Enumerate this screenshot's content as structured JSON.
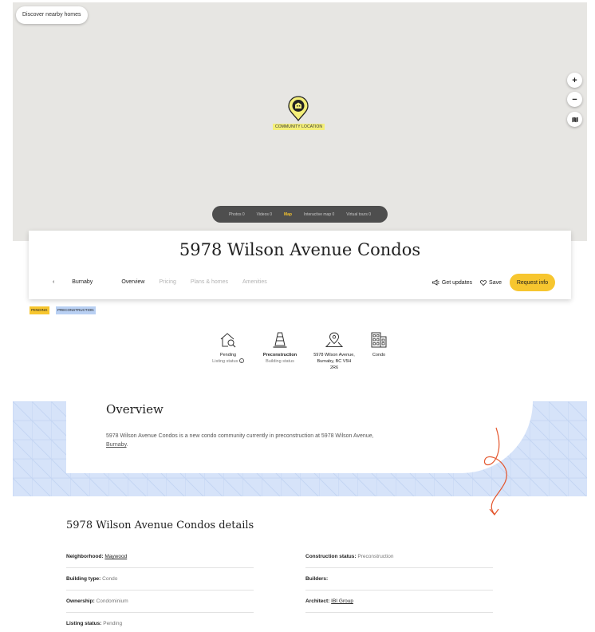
{
  "map": {
    "discover_label": "Discover nearby homes",
    "zoom_in": "+",
    "zoom_out": "−",
    "pin_label": "COMMUNITY LOCATION",
    "media_tabs": [
      {
        "label": "Photos 0",
        "active": false
      },
      {
        "label": "Videos 0",
        "active": false
      },
      {
        "label": "Map",
        "active": true
      },
      {
        "label": "Interactive map 0",
        "active": false
      },
      {
        "label": "Virtual tours 0",
        "active": false
      }
    ]
  },
  "header": {
    "title": "5978 Wilson Avenue Condos",
    "nav": {
      "back": "Burnaby",
      "overview": "Overview",
      "pricing": "Pricing",
      "plans": "Plans & homes",
      "amenities": "Amenities"
    },
    "actions": {
      "get_updates": "Get updates",
      "save": "Save",
      "request_info": "Request info"
    }
  },
  "badges": {
    "pending": "PENDING",
    "preconstruction": "PRECONSTRUCTION"
  },
  "facts": [
    {
      "icon": "house-search-icon",
      "value": "Pending",
      "label": "Listing status"
    },
    {
      "icon": "traffic-cone-icon",
      "value": "Preconstruction",
      "label": "Building status"
    },
    {
      "icon": "map-location-icon",
      "value": "5978 Wilson Avenue, Burnaby, BC V5H 2R6",
      "label": ""
    },
    {
      "icon": "building-icon",
      "value": "Condo",
      "label": ""
    }
  ],
  "overview": {
    "heading": "Overview",
    "text_before": "5978 Wilson Avenue Condos is a new condo community currently in preconstruction at 5978 Wilson Avenue, ",
    "link": "Burnaby",
    "text_after": "."
  },
  "details": {
    "heading": "5978 Wilson Avenue Condos details",
    "left": [
      {
        "label": "Neighborhood:",
        "value": "Maywood",
        "link": true
      },
      {
        "label": "Building type:",
        "value": "Condo",
        "link": false
      },
      {
        "label": "Ownership:",
        "value": "Condominium",
        "link": false
      },
      {
        "label": "Listing status:",
        "value": "Pending",
        "link": false
      }
    ],
    "right": [
      {
        "label": "Construction status:",
        "value": "Preconstruction",
        "link": false
      },
      {
        "label": "Builders:",
        "value": "",
        "link": false
      },
      {
        "label": "Architect:",
        "value": "IBI Group",
        "link": true
      }
    ]
  },
  "colors": {
    "accent_yellow": "#f7c62f",
    "badge_blue": "#b9d0f3",
    "overview_band": "#d6e3f9",
    "squiggle": "#e4572e"
  }
}
